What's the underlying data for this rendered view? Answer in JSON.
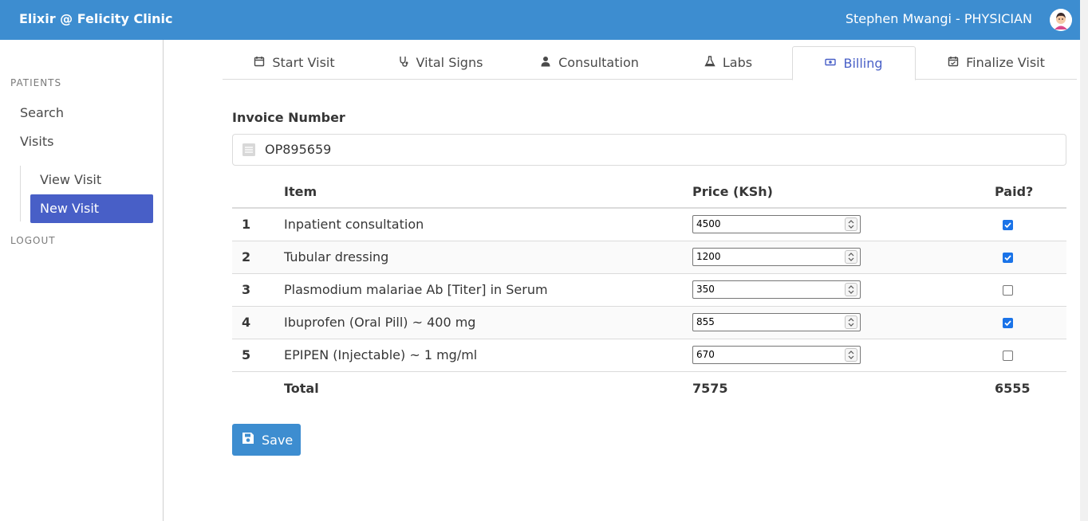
{
  "header": {
    "brand": "Elixir @ Felicity Clinic",
    "user": "Stephen Mwangi - PHYSICIAN",
    "avatar_icon": "user-avatar-icon",
    "accent_color": "#3d8dd0"
  },
  "sidebar": {
    "section_label": "PATIENTS",
    "items": [
      "Search",
      "Visits"
    ],
    "subitems": [
      "View Visit",
      "New Visit"
    ],
    "active_subitem": "New Visit",
    "logout": "LOGOUT"
  },
  "tabs": [
    {
      "label": "Start Visit",
      "icon": "calendar-icon"
    },
    {
      "label": "Vital Signs",
      "icon": "stethoscope-icon"
    },
    {
      "label": "Consultation",
      "icon": "doctor-icon"
    },
    {
      "label": "Labs",
      "icon": "flask-icon"
    },
    {
      "label": "Billing",
      "icon": "money-icon",
      "active": true
    },
    {
      "label": "Finalize Visit",
      "icon": "calendar-check-icon"
    }
  ],
  "invoice": {
    "label": "Invoice Number",
    "value": "OP895659"
  },
  "table": {
    "headers": [
      "",
      "Item",
      "Price (KSh)",
      "Paid?"
    ],
    "rows": [
      {
        "num": "1",
        "item": "Inpatient consultation",
        "price": "4500",
        "paid": true
      },
      {
        "num": "2",
        "item": "Tubular dressing",
        "price": "1200",
        "paid": true
      },
      {
        "num": "3",
        "item": "Plasmodium malariae Ab [Titer] in Serum",
        "price": "350",
        "paid": false
      },
      {
        "num": "4",
        "item": "Ibuprofen (Oral Pill) ~ 400 mg",
        "price": "855",
        "paid": true
      },
      {
        "num": "5",
        "item": "EPIPEN (Injectable) ~ 1 mg/ml",
        "price": "670",
        "paid": false
      }
    ],
    "total_label": "Total",
    "total_price": "7575",
    "total_paid": "6555"
  },
  "save_button": {
    "label": "Save",
    "icon": "save-icon"
  }
}
